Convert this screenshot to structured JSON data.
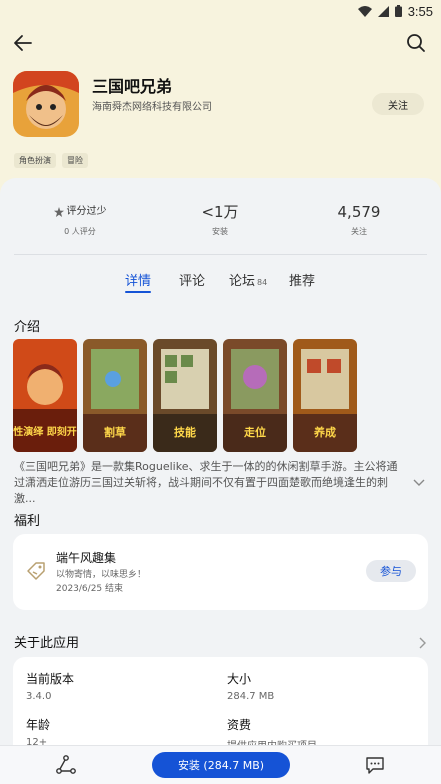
{
  "status": {
    "time": "3:55"
  },
  "app": {
    "name": "三国吧兄弟",
    "developer": "海南舜杰网络科技有限公司",
    "follow_label": "关注",
    "tags": [
      "角色扮演",
      "冒险"
    ]
  },
  "stats": {
    "rating_label": "评分过少",
    "rating_count": "0 人评分",
    "installs": "<1万",
    "installs_label": "安装",
    "follows": "4,579",
    "follows_label": "关注"
  },
  "tabs": {
    "details": "详情",
    "reviews": "评论",
    "forum": "论坛",
    "forum_count": "84",
    "recommend": "推荐"
  },
  "intro": {
    "title": "介绍",
    "screenshots": [
      {
        "caption": "魔性演绎 即刻开战",
        "bg": "#d04a18"
      },
      {
        "caption": "割草",
        "bg": "#3a6fb0"
      },
      {
        "caption": "技能",
        "bg": "#2f7a3a"
      },
      {
        "caption": "走位",
        "bg": "#b04aa8"
      },
      {
        "caption": "养成",
        "bg": "#c87a1a"
      }
    ],
    "description": "《三国吧兄弟》是一款集Roguelike、求生于一体的的休闲割草手游。主公将通过潇洒走位游历三国过关斩将，战斗期间不仅有置于四面楚歌而绝境逢生的刺激..."
  },
  "benefits": {
    "title": "福利",
    "card_title": "端午风趣集",
    "card_sub": "以物寄情，以味思乡！",
    "card_date": "2023/6/25 结束",
    "join_label": "参与"
  },
  "about": {
    "title": "关于此应用",
    "version_label": "当前版本",
    "version": "3.4.0",
    "size_label": "大小",
    "size": "284.7 MB",
    "age_label": "年龄",
    "age": "12+",
    "fee_label": "资费",
    "fee": "提供应用内购买项目"
  },
  "bottom": {
    "install_label": "安装 (284.7 MB)"
  },
  "colors": {
    "accent": "#1553d6",
    "header_bg": "#f7f3de",
    "sheet_bg": "#f1f3f5"
  }
}
